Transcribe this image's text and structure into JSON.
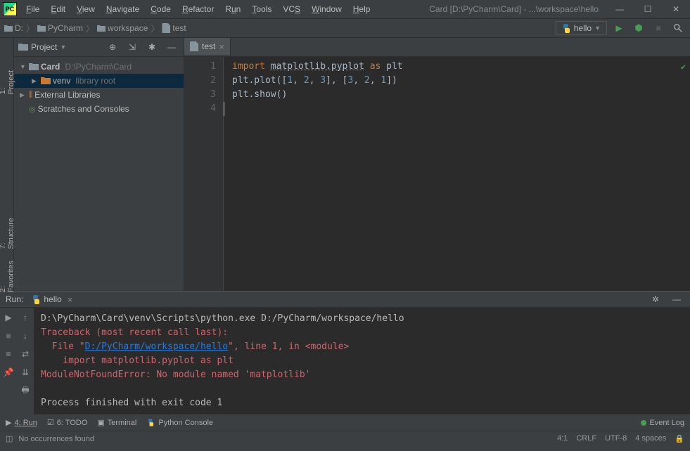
{
  "title": "Card [D:\\PyCharm\\Card] - ...\\workspace\\hello",
  "menu": [
    "File",
    "Edit",
    "View",
    "Navigate",
    "Code",
    "Refactor",
    "Run",
    "Tools",
    "VCS",
    "Window",
    "Help"
  ],
  "breadcrumb": [
    {
      "label": "D:",
      "icon": "folder"
    },
    {
      "label": "PyCharm",
      "icon": "folder"
    },
    {
      "label": "workspace",
      "icon": "folder"
    },
    {
      "label": "test",
      "icon": "file"
    }
  ],
  "run_config": "hello",
  "project_panel": {
    "title": "Project"
  },
  "tree": {
    "root": {
      "name": "Card",
      "path": "D:\\PyCharm\\Card"
    },
    "venv": {
      "name": "venv",
      "hint": "library root"
    },
    "ext_lib": "External Libraries",
    "scratch": "Scratches and Consoles"
  },
  "editor_tab": "test",
  "code_lines": [
    "import matplotlib.pyplot as plt",
    "plt.plot([1, 2, 3], [3, 2, 1])",
    "plt.show()",
    ""
  ],
  "line_numbers": [
    "1",
    "2",
    "3",
    "4"
  ],
  "run_tab": {
    "label": "Run:",
    "file": "hello"
  },
  "console": {
    "cmd": "D:\\PyCharm\\Card\\venv\\Scripts\\python.exe D:/PyCharm/workspace/hello",
    "trace": "Traceback (most recent call last):",
    "file_prefix": "  File \"",
    "file_link": "D:/PyCharm/workspace/hello",
    "file_suffix": "\", line 1, in <module>",
    "imp": "    import matplotlib.pyplot as plt",
    "err": "ModuleNotFoundError: No module named 'matplotlib'",
    "exit": "Process finished with exit code 1"
  },
  "bottom": {
    "run": "4: Run",
    "todo": "6: TODO",
    "terminal": "Terminal",
    "pyconsole": "Python Console",
    "eventlog": "Event Log"
  },
  "status": {
    "msg": "No occurrences found",
    "pos": "4:1",
    "eol": "CRLF",
    "enc": "UTF-8",
    "indent": "4 spaces"
  },
  "gutter_tabs": {
    "project": "1: Project",
    "structure": "7: Structure",
    "favorites": "2: Favorites"
  }
}
